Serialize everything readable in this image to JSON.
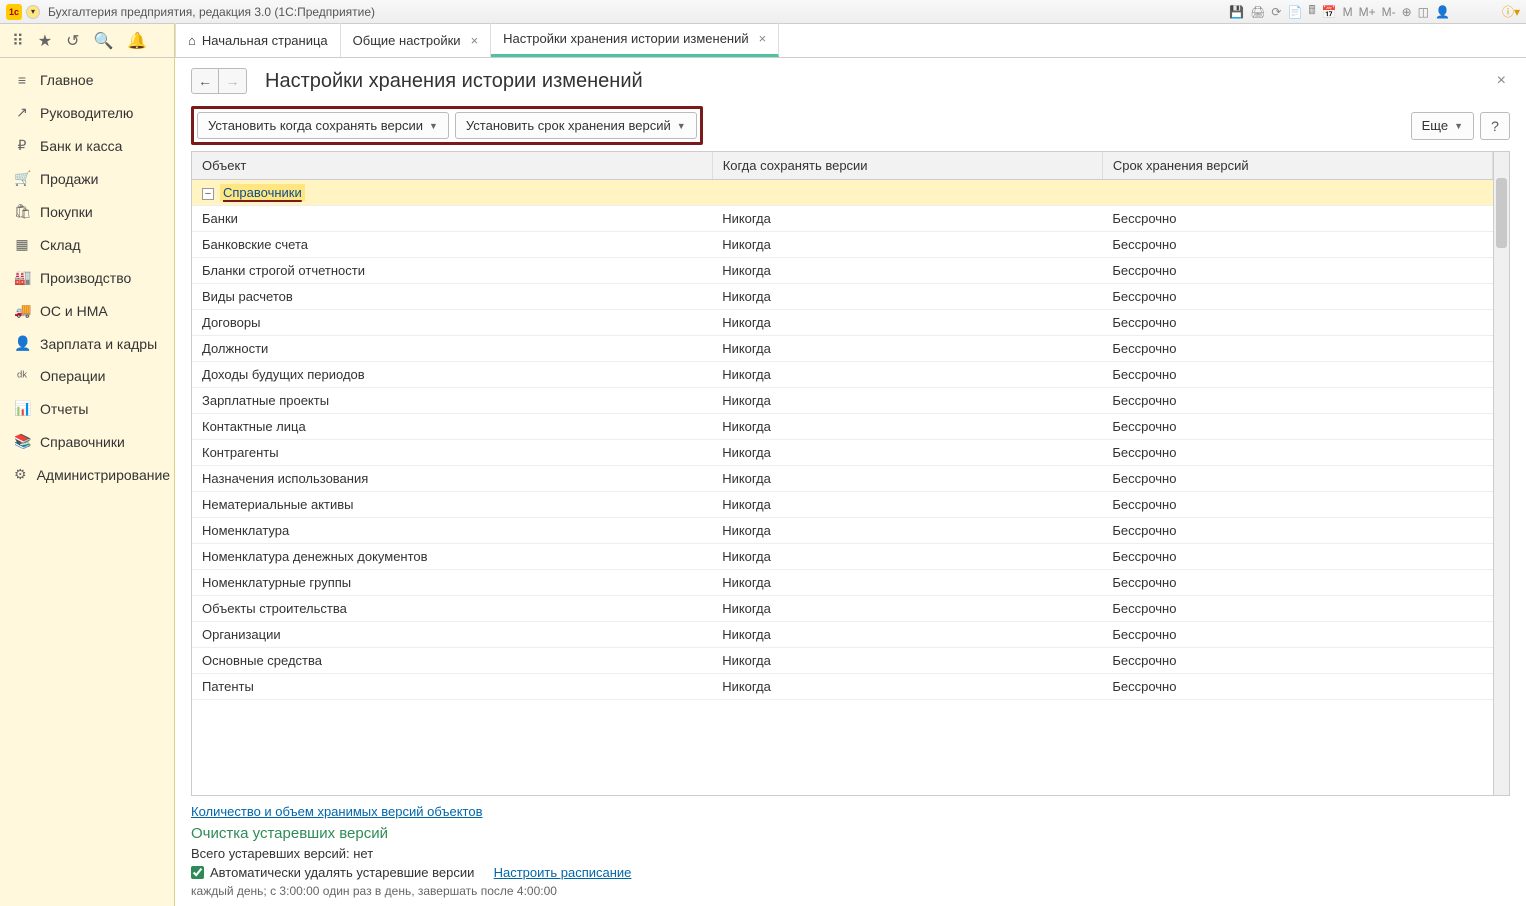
{
  "titlebar": {
    "logo_text": "1c",
    "title": "Бухгалтерия предприятия, редакция 3.0  (1С:Предприятие)",
    "icons": [
      "save-icon",
      "print-icon",
      "refresh-icon",
      "doc-icon",
      "calc-icon",
      "calendar-icon",
      "m-icon",
      "m-plus-icon",
      "m-minus-icon",
      "zoom-in-icon",
      "window-icon",
      "user-icon",
      "info-icon"
    ]
  },
  "toolstrip": {
    "icons": [
      "apps-icon",
      "star-icon",
      "history-icon",
      "search-icon",
      "bell-icon"
    ]
  },
  "tabs": {
    "home": "Начальная страница",
    "items": [
      {
        "label": "Общие настройки",
        "active": false
      },
      {
        "label": "Настройки хранения истории изменений",
        "active": true
      }
    ]
  },
  "sidebar": {
    "items": [
      {
        "icon": "≡",
        "label": "Главное"
      },
      {
        "icon": "↗",
        "label": "Руководителю"
      },
      {
        "icon": "₽",
        "label": "Банк и касса"
      },
      {
        "icon": "🛒",
        "label": "Продажи"
      },
      {
        "icon": "🛍",
        "label": "Покупки"
      },
      {
        "icon": "▦",
        "label": "Склад"
      },
      {
        "icon": "🏭",
        "label": "Производство"
      },
      {
        "icon": "🚚",
        "label": "ОС и НМА"
      },
      {
        "icon": "👤",
        "label": "Зарплата и кадры"
      },
      {
        "icon": "ᵈᵏ",
        "label": "Операции"
      },
      {
        "icon": "📊",
        "label": "Отчеты"
      },
      {
        "icon": "📚",
        "label": "Справочники"
      },
      {
        "icon": "⚙",
        "label": "Администрирование"
      }
    ]
  },
  "page": {
    "title": "Настройки хранения истории изменений",
    "btn_when": "Установить когда сохранять версии",
    "btn_term": "Установить срок хранения версий",
    "btn_more": "Еще",
    "btn_help": "?",
    "columns": {
      "object": "Объект",
      "when": "Когда сохранять версии",
      "term": "Срок хранения версий"
    },
    "group_label": "Справочники",
    "rows": [
      {
        "name": "Банки",
        "when": "Никогда",
        "term": "Бессрочно"
      },
      {
        "name": "Банковские счета",
        "when": "Никогда",
        "term": "Бессрочно"
      },
      {
        "name": "Бланки строгой отчетности",
        "when": "Никогда",
        "term": "Бессрочно"
      },
      {
        "name": "Виды расчетов",
        "when": "Никогда",
        "term": "Бессрочно"
      },
      {
        "name": "Договоры",
        "when": "Никогда",
        "term": "Бессрочно"
      },
      {
        "name": "Должности",
        "when": "Никогда",
        "term": "Бессрочно"
      },
      {
        "name": "Доходы будущих периодов",
        "when": "Никогда",
        "term": "Бессрочно"
      },
      {
        "name": "Зарплатные проекты",
        "when": "Никогда",
        "term": "Бессрочно"
      },
      {
        "name": "Контактные лица",
        "when": "Никогда",
        "term": "Бессрочно"
      },
      {
        "name": "Контрагенты",
        "when": "Никогда",
        "term": "Бессрочно"
      },
      {
        "name": "Назначения использования",
        "when": "Никогда",
        "term": "Бессрочно"
      },
      {
        "name": "Нематериальные активы",
        "when": "Никогда",
        "term": "Бессрочно"
      },
      {
        "name": "Номенклатура",
        "when": "Никогда",
        "term": "Бессрочно"
      },
      {
        "name": "Номенклатура денежных документов",
        "when": "Никогда",
        "term": "Бессрочно"
      },
      {
        "name": "Номенклатурные группы",
        "when": "Никогда",
        "term": "Бессрочно"
      },
      {
        "name": "Объекты строительства",
        "when": "Никогда",
        "term": "Бессрочно"
      },
      {
        "name": "Организации",
        "when": "Никогда",
        "term": "Бессрочно"
      },
      {
        "name": "Основные средства",
        "when": "Никогда",
        "term": "Бессрочно"
      },
      {
        "name": "Патенты",
        "when": "Никогда",
        "term": "Бессрочно"
      }
    ],
    "link_count": "Количество и объем хранимых версий объектов",
    "section_cleanup": "Очистка устаревших версий",
    "total_outdated": "Всего устаревших версий: нет",
    "auto_delete": "Автоматически удалять устаревшие версии",
    "link_schedule": "Настроить расписание",
    "schedule_text": "каждый день; с 3:00:00 один раз в день, завершать после 4:00:00"
  }
}
